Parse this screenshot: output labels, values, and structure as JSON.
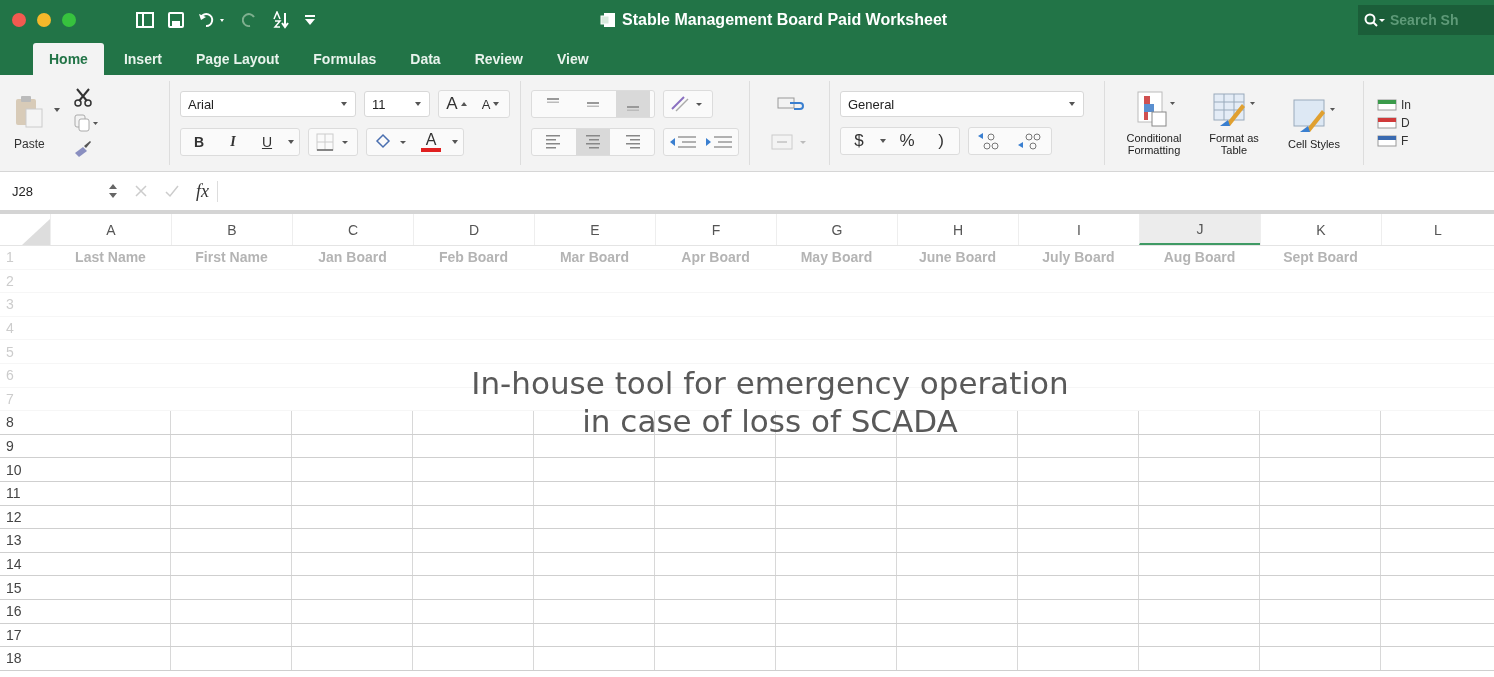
{
  "window": {
    "title": "Stable Management Board Paid Worksheet"
  },
  "search": {
    "placeholder": "Search Sh"
  },
  "tabs": [
    {
      "label": "Home",
      "selected": true
    },
    {
      "label": "Insert",
      "selected": false
    },
    {
      "label": "Page Layout",
      "selected": false
    },
    {
      "label": "Formulas",
      "selected": false
    },
    {
      "label": "Data",
      "selected": false
    },
    {
      "label": "Review",
      "selected": false
    },
    {
      "label": "View",
      "selected": false
    }
  ],
  "ribbon": {
    "paste_label": "Paste",
    "font": {
      "value": "Arial"
    },
    "size": {
      "value": "11"
    },
    "grow_label": "A",
    "shrink_label": "A",
    "bold_label": "B",
    "italic_label": "I",
    "underline_label": "U",
    "font_color_label": "A",
    "vertical_align": [
      {
        "selected": false
      },
      {
        "selected": false
      },
      {
        "selected": true
      }
    ],
    "horizontal_align": [
      {
        "selected": false
      },
      {
        "selected": true
      },
      {
        "selected": false
      }
    ],
    "number_format": {
      "value": "General"
    },
    "currency_label": "$",
    "percent_label": "%",
    "comma_label": ")",
    "styles": [
      {
        "label": "Conditional Formatting",
        "kind": "conditional"
      },
      {
        "label": "Format as Table",
        "kind": "table"
      },
      {
        "label": "Cell Styles",
        "kind": "cellstyle"
      }
    ],
    "cells_group": [
      {
        "label": "In",
        "kind": "insert"
      },
      {
        "label": "D",
        "kind": "delete"
      },
      {
        "label": "F",
        "kind": "format"
      }
    ]
  },
  "formula_bar": {
    "name_box": "J28",
    "fx": "fx"
  },
  "sheet": {
    "columns": [
      {
        "label": "A",
        "selected": false
      },
      {
        "label": "B",
        "selected": false
      },
      {
        "label": "C",
        "selected": false
      },
      {
        "label": "D",
        "selected": false
      },
      {
        "label": "E",
        "selected": false
      },
      {
        "label": "F",
        "selected": false
      },
      {
        "label": "G",
        "selected": false
      },
      {
        "label": "H",
        "selected": false
      },
      {
        "label": "I",
        "selected": false
      },
      {
        "label": "J",
        "selected": true
      },
      {
        "label": "K",
        "selected": false
      },
      {
        "label": "L",
        "selected": false
      }
    ],
    "rows": [
      {
        "number": "1",
        "cells": [
          "Last Name",
          "First Name",
          "Jan Board",
          "Feb Board",
          "Mar Board",
          "Apr Board",
          "May Board",
          "June Board",
          "July Board",
          "Aug Board",
          "Sept Board"
        ]
      },
      {
        "number": "2",
        "cells": []
      },
      {
        "number": "3",
        "cells": []
      },
      {
        "number": "4",
        "cells": []
      },
      {
        "number": "5",
        "cells": []
      },
      {
        "number": "6",
        "cells": []
      },
      {
        "number": "7",
        "cells": []
      },
      {
        "number": "8",
        "cells": []
      },
      {
        "number": "9",
        "cells": []
      },
      {
        "number": "10",
        "cells": []
      },
      {
        "number": "11",
        "cells": []
      },
      {
        "number": "12",
        "cells": []
      },
      {
        "number": "13",
        "cells": []
      },
      {
        "number": "14",
        "cells": []
      },
      {
        "number": "15",
        "cells": []
      },
      {
        "number": "16",
        "cells": []
      },
      {
        "number": "17",
        "cells": []
      },
      {
        "number": "18",
        "cells": []
      }
    ]
  },
  "caption": [
    "In-house tool for emergency operation",
    "in case of loss of SCADA"
  ]
}
